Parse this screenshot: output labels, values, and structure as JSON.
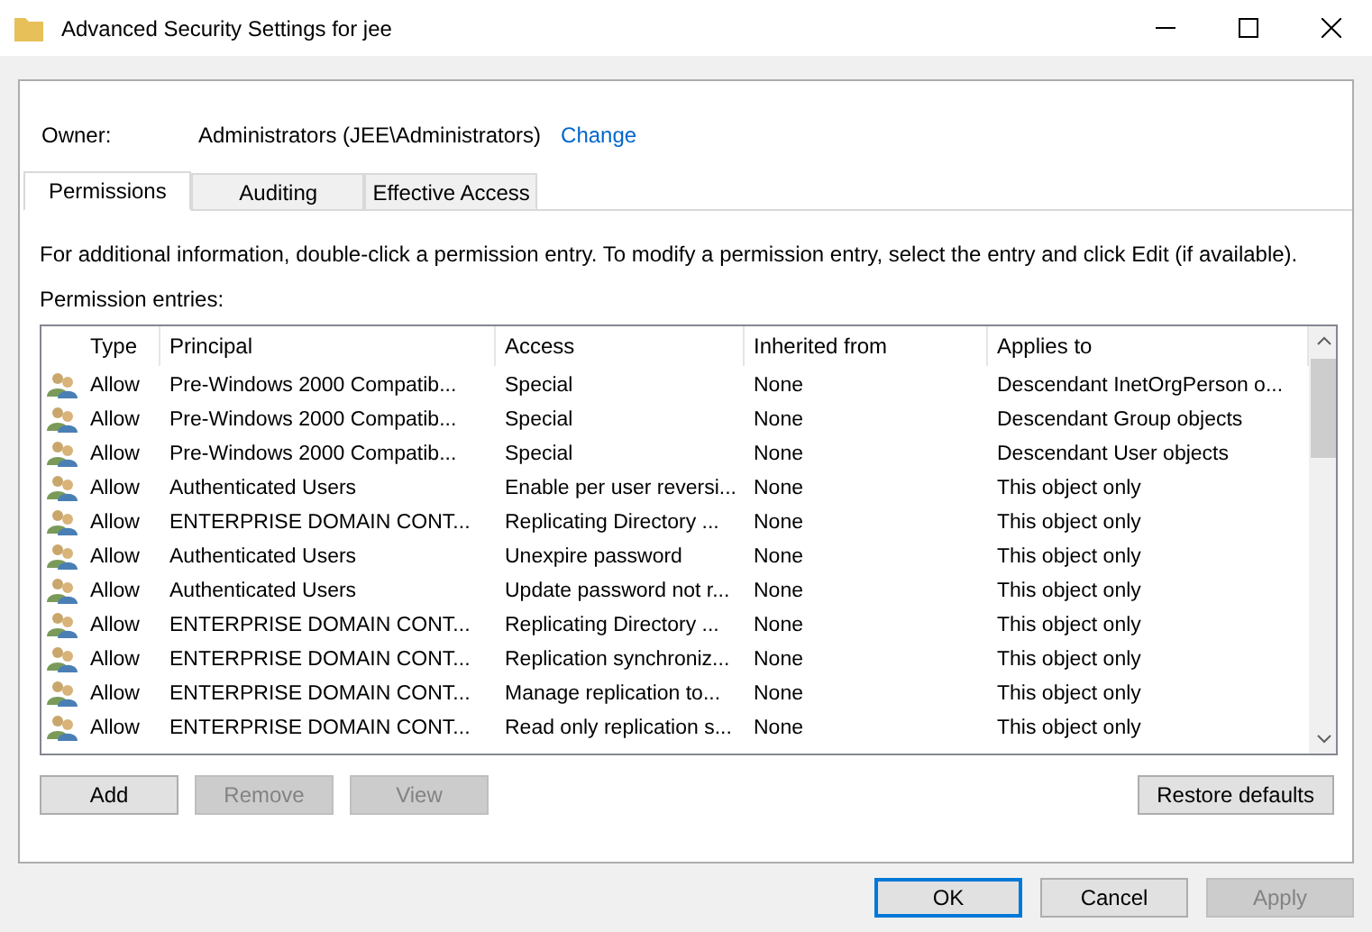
{
  "window": {
    "title": "Advanced Security Settings for jee"
  },
  "owner": {
    "label": "Owner:",
    "value": "Administrators (JEE\\Administrators)",
    "link": "Change"
  },
  "tabs": [
    {
      "label": "Permissions",
      "selected": true
    },
    {
      "label": "Auditing",
      "selected": false
    },
    {
      "label": "Effective Access",
      "selected": false
    }
  ],
  "info": "For additional information, double-click a permission entry. To modify a permission entry, select the entry and click Edit (if available).",
  "entries_label": "Permission entries:",
  "table": {
    "columns": [
      "Type",
      "Principal",
      "Access",
      "Inherited from",
      "Applies to"
    ],
    "rows": [
      [
        "Allow",
        "Pre-Windows 2000 Compatib...",
        "Special",
        "None",
        "Descendant InetOrgPerson o..."
      ],
      [
        "Allow",
        "Pre-Windows 2000 Compatib...",
        "Special",
        "None",
        "Descendant Group objects"
      ],
      [
        "Allow",
        "Pre-Windows 2000 Compatib...",
        "Special",
        "None",
        "Descendant User objects"
      ],
      [
        "Allow",
        "Authenticated Users",
        "Enable per user reversi...",
        "None",
        "This object only"
      ],
      [
        "Allow",
        "ENTERPRISE DOMAIN CONT...",
        "Replicating Directory ...",
        "None",
        "This object only"
      ],
      [
        "Allow",
        "Authenticated Users",
        "Unexpire password",
        "None",
        "This object only"
      ],
      [
        "Allow",
        "Authenticated Users",
        "Update password not r...",
        "None",
        "This object only"
      ],
      [
        "Allow",
        "ENTERPRISE DOMAIN CONT...",
        "Replicating Directory ...",
        "None",
        "This object only"
      ],
      [
        "Allow",
        "ENTERPRISE DOMAIN CONT...",
        "Replication synchroniz...",
        "None",
        "This object only"
      ],
      [
        "Allow",
        "ENTERPRISE DOMAIN CONT...",
        "Manage replication to...",
        "None",
        "This object only"
      ],
      [
        "Allow",
        "ENTERPRISE DOMAIN CONT...",
        "Read only replication s...",
        "None",
        "This object only"
      ]
    ]
  },
  "list_buttons": [
    {
      "label": "Add",
      "disabled": false
    },
    {
      "label": "Remove",
      "disabled": true
    },
    {
      "label": "View",
      "disabled": true
    }
  ],
  "restore_button": {
    "label": "Restore defaults",
    "disabled": false
  },
  "dialog_buttons": [
    {
      "label": "OK",
      "disabled": false,
      "default": true
    },
    {
      "label": "Cancel",
      "disabled": false,
      "default": false
    },
    {
      "label": "Apply",
      "disabled": true,
      "default": false
    }
  ]
}
